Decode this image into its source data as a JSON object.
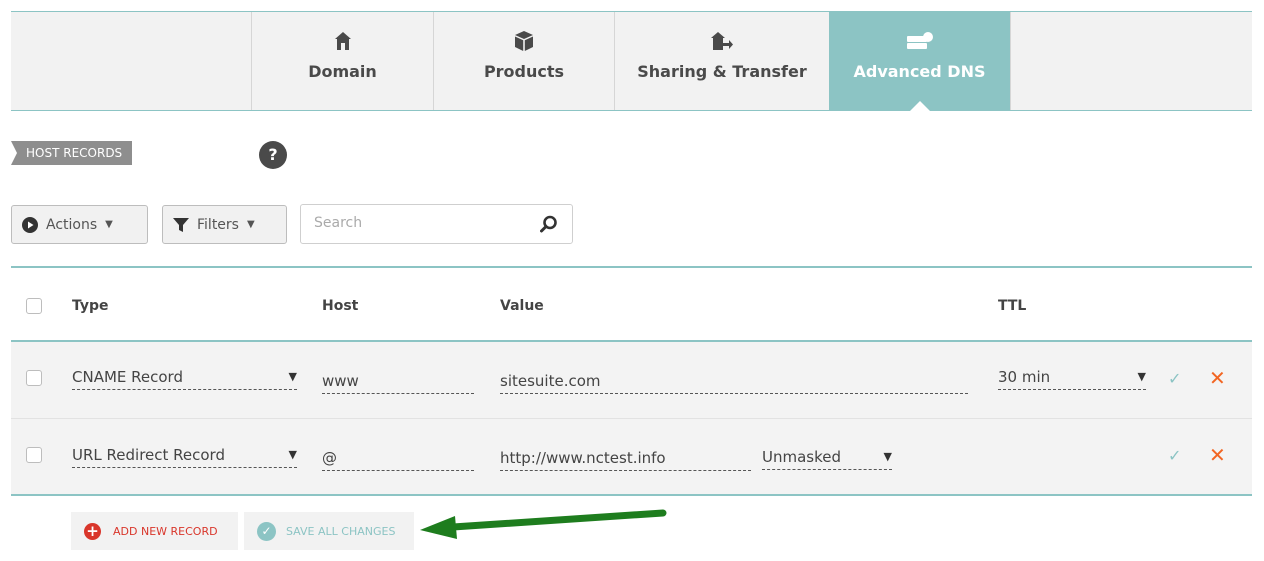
{
  "tabs": [
    {
      "label": "Domain",
      "icon": "home-icon"
    },
    {
      "label": "Products",
      "icon": "box-icon"
    },
    {
      "label": "Sharing & Transfer",
      "icon": "house-arrow-icon"
    },
    {
      "label": "Advanced DNS",
      "icon": "server-icon",
      "active": true
    }
  ],
  "section": {
    "label": "HOST RECORDS",
    "help": "?"
  },
  "toolbar": {
    "actions_label": "Actions",
    "filters_label": "Filters",
    "search_placeholder": "Search"
  },
  "table": {
    "headers": {
      "type": "Type",
      "host": "Host",
      "value": "Value",
      "ttl": "TTL"
    },
    "rows": [
      {
        "type": "CNAME Record",
        "host": "www",
        "value": "sitesuite.com",
        "ttl": "30 min",
        "extra": ""
      },
      {
        "type": "URL Redirect Record",
        "host": "@",
        "value": "http://www.nctest.info",
        "ttl": "",
        "extra": "Unmasked"
      }
    ]
  },
  "buttons": {
    "add_label": "ADD NEW RECORD",
    "save_label": "SAVE ALL CHANGES"
  },
  "colors": {
    "accent": "#8cc4c4",
    "danger": "#d9362b",
    "close": "#f26522",
    "arrow": "#1e7d1e"
  }
}
